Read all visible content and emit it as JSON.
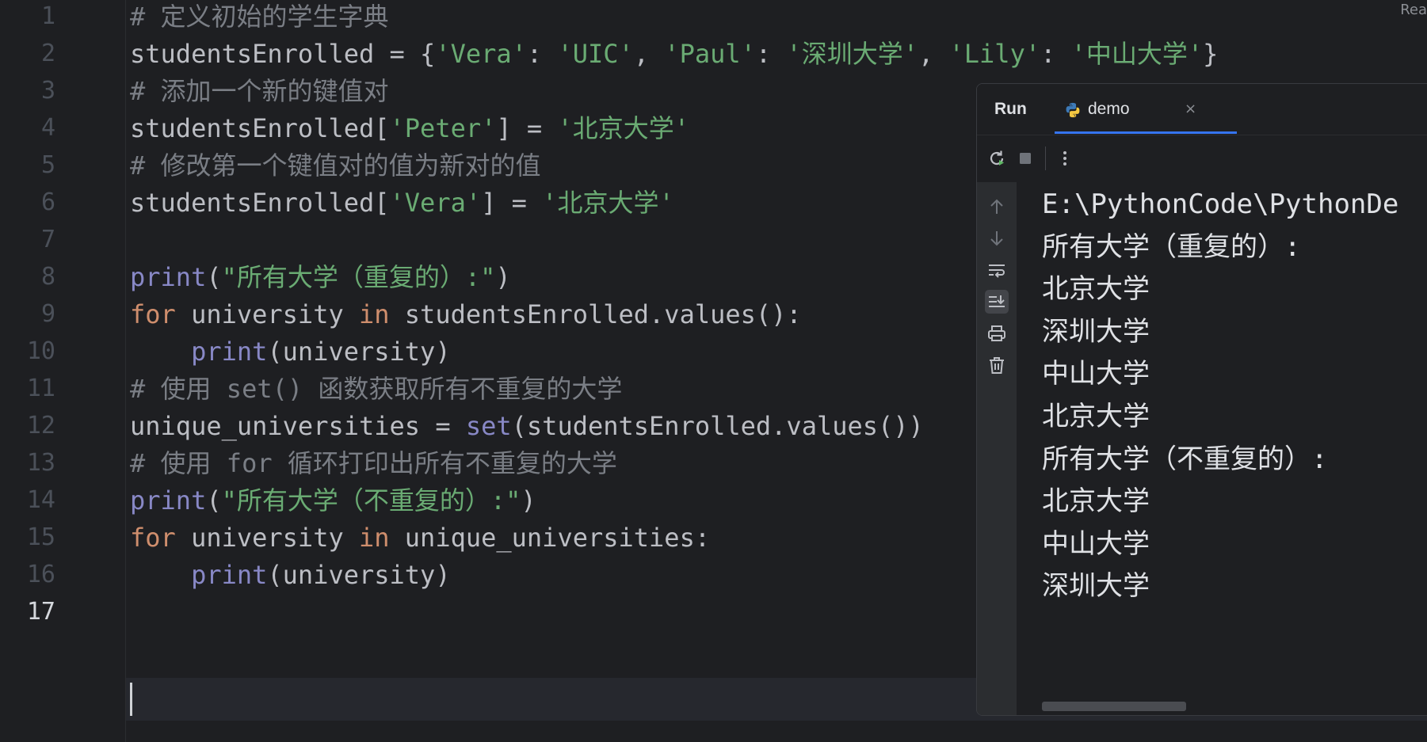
{
  "editor": {
    "line_numbers": [
      "1",
      "2",
      "3",
      "4",
      "5",
      "6",
      "7",
      "8",
      "9",
      "10",
      "11",
      "12",
      "13",
      "14",
      "15",
      "16",
      "17"
    ],
    "current_line": "17",
    "lines": [
      [
        {
          "t": "comment",
          "v": "# 定义初始的学生字典"
        }
      ],
      [
        {
          "t": "plain",
          "v": "studentsEnrolled = {"
        },
        {
          "t": "str",
          "v": "'Vera'"
        },
        {
          "t": "plain",
          "v": ": "
        },
        {
          "t": "str",
          "v": "'UIC'"
        },
        {
          "t": "plain",
          "v": ", "
        },
        {
          "t": "str",
          "v": "'Paul'"
        },
        {
          "t": "plain",
          "v": ": "
        },
        {
          "t": "str",
          "v": "'深圳大学'"
        },
        {
          "t": "plain",
          "v": ", "
        },
        {
          "t": "str",
          "v": "'Lily'"
        },
        {
          "t": "plain",
          "v": ": "
        },
        {
          "t": "str",
          "v": "'中山大学'"
        },
        {
          "t": "plain",
          "v": "}"
        }
      ],
      [
        {
          "t": "comment",
          "v": "# 添加一个新的键值对"
        }
      ],
      [
        {
          "t": "plain",
          "v": "studentsEnrolled["
        },
        {
          "t": "str",
          "v": "'Peter'"
        },
        {
          "t": "plain",
          "v": "] = "
        },
        {
          "t": "str",
          "v": "'北京大学'"
        }
      ],
      [
        {
          "t": "comment",
          "v": "# 修改第一个键值对的值为新对的值"
        }
      ],
      [
        {
          "t": "plain",
          "v": "studentsEnrolled["
        },
        {
          "t": "str",
          "v": "'Vera'"
        },
        {
          "t": "plain",
          "v": "] = "
        },
        {
          "t": "str",
          "v": "'北京大学'"
        }
      ],
      [],
      [
        {
          "t": "builtin",
          "v": "print"
        },
        {
          "t": "plain",
          "v": "("
        },
        {
          "t": "str",
          "v": "\"所有大学（重复的）:\""
        },
        {
          "t": "plain",
          "v": ")"
        }
      ],
      [
        {
          "t": "kw",
          "v": "for"
        },
        {
          "t": "plain",
          "v": " university "
        },
        {
          "t": "kw",
          "v": "in"
        },
        {
          "t": "plain",
          "v": " studentsEnrolled.values():"
        }
      ],
      [
        {
          "t": "plain",
          "v": "    "
        },
        {
          "t": "builtin",
          "v": "print"
        },
        {
          "t": "plain",
          "v": "(university)"
        }
      ],
      [
        {
          "t": "comment",
          "v": "# 使用 set() 函数获取所有不重复的大学"
        }
      ],
      [
        {
          "t": "plain",
          "v": "unique_universities = "
        },
        {
          "t": "builtin",
          "v": "set"
        },
        {
          "t": "plain",
          "v": "(studentsEnrolled.values())"
        }
      ],
      [
        {
          "t": "comment",
          "v": "# 使用 for 循环打印出所有不重复的大学"
        }
      ],
      [
        {
          "t": "builtin",
          "v": "print"
        },
        {
          "t": "plain",
          "v": "("
        },
        {
          "t": "str",
          "v": "\"所有大学（不重复的）:\""
        },
        {
          "t": "plain",
          "v": ")"
        }
      ],
      [
        {
          "t": "kw",
          "v": "for"
        },
        {
          "t": "plain",
          "v": " university "
        },
        {
          "t": "kw",
          "v": "in"
        },
        {
          "t": "plain",
          "v": " unique_universities:"
        }
      ],
      [
        {
          "t": "plain",
          "v": "    "
        },
        {
          "t": "builtin",
          "v": "print"
        },
        {
          "t": "plain",
          "v": "(university)"
        }
      ],
      []
    ],
    "corner_label": "Rea"
  },
  "run_panel": {
    "title": "Run",
    "tab_label": "demo",
    "tab_close": "×",
    "icons": {
      "rerun": "rerun-icon",
      "stop": "stop-icon",
      "more": "more-vertical-icon",
      "up": "arrow-up-icon",
      "down": "arrow-down-icon",
      "wrap": "soft-wrap-icon",
      "scroll_end": "scroll-to-end-icon",
      "print": "print-icon",
      "clear": "trash-icon"
    },
    "console_lines": [
      "E:\\PythonCode\\PythonDe",
      "所有大学（重复的）:",
      "北京大学",
      "深圳大学",
      "中山大学",
      "北京大学",
      "所有大学（不重复的）:",
      "北京大学",
      "中山大学",
      "深圳大学"
    ]
  },
  "colors": {
    "background": "#1e1f22",
    "comment": "#7a7e85",
    "string": "#6aab73",
    "keyword": "#cf8e6d",
    "builtin": "#8888c6",
    "text": "#bcbec4",
    "accent": "#3574f0",
    "rerun_green": "#5fb865"
  }
}
